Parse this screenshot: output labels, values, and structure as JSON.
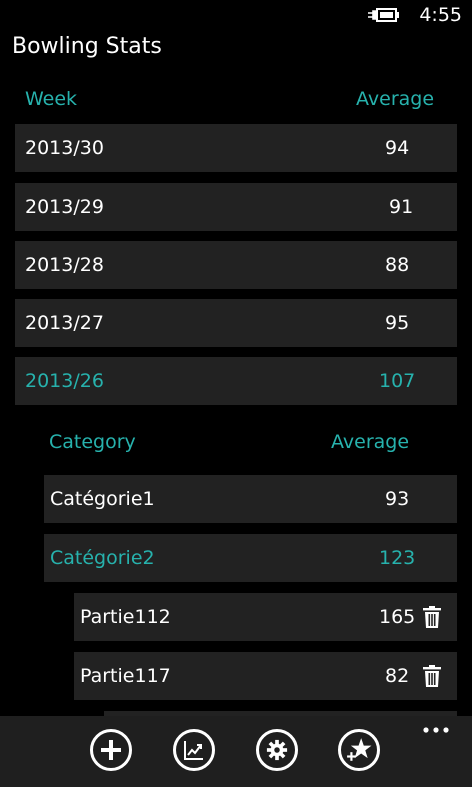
{
  "status": {
    "time": "4:55"
  },
  "app": {
    "title": "Bowling Stats"
  },
  "weeks": {
    "header": {
      "col1": "Week",
      "col2": "Average"
    },
    "rows": [
      {
        "label": "2013/30",
        "value": "94"
      },
      {
        "label": "2013/29",
        "value": "91"
      },
      {
        "label": "2013/28",
        "value": "88"
      },
      {
        "label": "2013/27",
        "value": "95"
      },
      {
        "label": "2013/26",
        "value": "107"
      }
    ]
  },
  "categories": {
    "header": {
      "col1": "Category",
      "col2": "Average"
    },
    "rows": [
      {
        "label": "Catégorie1",
        "value": "93"
      },
      {
        "label": "Catégorie2",
        "value": "123"
      }
    ]
  },
  "games": {
    "rows": [
      {
        "label": "Partie112",
        "value": "165"
      },
      {
        "label": "Partie117",
        "value": "82"
      }
    ]
  },
  "appbar": {
    "buttons": [
      "add-icon",
      "chart-icon",
      "settings-icon",
      "favorite-add-icon"
    ],
    "more": "more-icon"
  },
  "colors": {
    "accent": "#27b2ad",
    "row_bg": "#222222",
    "appbar_bg": "#1f1f1f"
  }
}
